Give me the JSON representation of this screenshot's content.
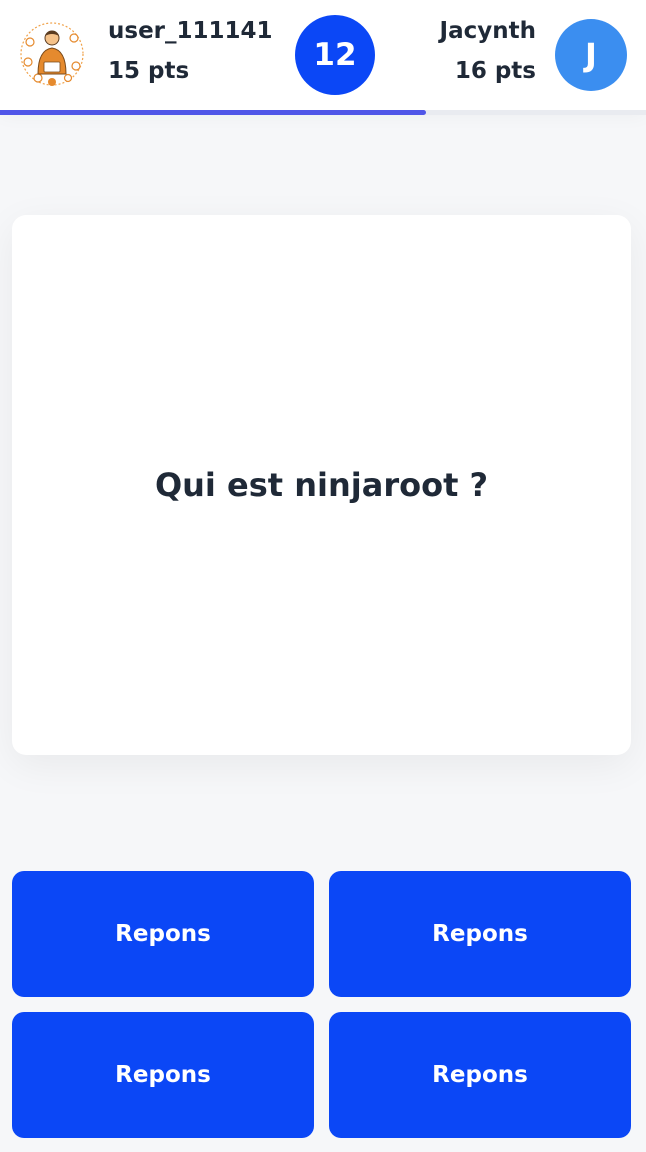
{
  "header": {
    "player_left": {
      "name": "user_111141",
      "points": "15 pts",
      "avatar_icon": "avatar-illustration-icon"
    },
    "timer": "12",
    "player_right": {
      "name": "Jacynth",
      "points": "16 pts",
      "avatar_initial": "J",
      "avatar_color": "#3b8ef0"
    },
    "progress": 0.66,
    "progress_color": "#5056e8"
  },
  "question": {
    "text": "Qui est ninjaroot ?"
  },
  "answers": [
    {
      "label": "Repons"
    },
    {
      "label": "Repons"
    },
    {
      "label": "Repons"
    },
    {
      "label": "Repons"
    }
  ],
  "colors": {
    "accent": "#0b47f6",
    "text": "#1f2937",
    "background": "#f6f7f9"
  }
}
